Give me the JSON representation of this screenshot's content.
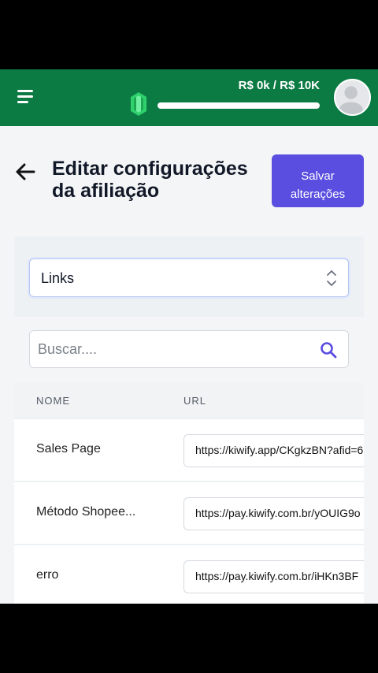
{
  "header": {
    "goal_text": "R$ 0k / R$ 10K",
    "progress_fraction": 1.0,
    "menu_icon": "hamburger-menu-icon",
    "gem_icon": "green-gem-icon",
    "avatar_icon": "user-avatar-icon"
  },
  "page": {
    "title_line1": "Editar configurações",
    "title_line2": "da afiliação",
    "save_line1": "Salvar",
    "save_line2": "alterações"
  },
  "select": {
    "value": "Links"
  },
  "search": {
    "placeholder": "Buscar...."
  },
  "table": {
    "columns": [
      "NOME",
      "URL"
    ],
    "rows": [
      {
        "name": "Sales Page",
        "url": "https://kiwify.app/CKgkzBN?afid=6"
      },
      {
        "name": "Método Shopee...",
        "url": "https://pay.kiwify.com.br/yOUIG9o"
      },
      {
        "name": "erro",
        "url": "https://pay.kiwify.com.br/iHKn3BF"
      }
    ]
  },
  "colors": {
    "header_green": "#0c7a43",
    "accent_purple": "#5a4ee0",
    "search_icon_color": "#5a4ee0"
  }
}
